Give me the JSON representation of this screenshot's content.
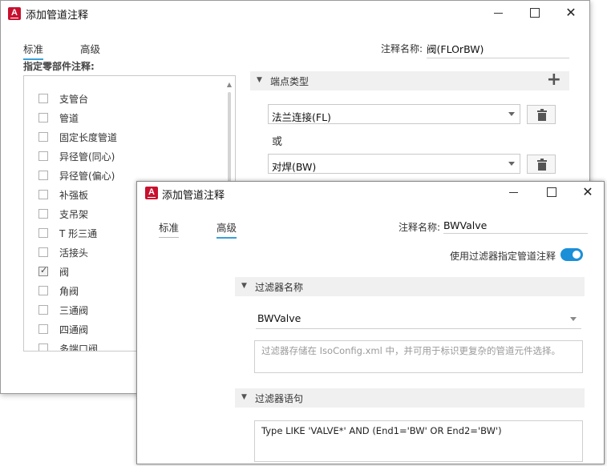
{
  "back_window": {
    "app_icon": "A",
    "title": "添加管道注释",
    "tabs": [
      {
        "label": "标准",
        "active": true
      },
      {
        "label": "高级",
        "active": false
      }
    ],
    "annotation_name_label": "注释名称:",
    "annotation_name_value": "阀(FLOrBW)",
    "parts_label": "指定零部件注释:",
    "parts": [
      {
        "label": "支管台",
        "checked": false
      },
      {
        "label": "管道",
        "checked": false
      },
      {
        "label": "固定长度管道",
        "checked": false
      },
      {
        "label": "异径管(同心)",
        "checked": false
      },
      {
        "label": "异径管(偏心)",
        "checked": false
      },
      {
        "label": "补强板",
        "checked": false
      },
      {
        "label": "支吊架",
        "checked": false
      },
      {
        "label": "T 形三通",
        "checked": false
      },
      {
        "label": "活接头",
        "checked": false
      },
      {
        "label": "阀",
        "checked": true
      },
      {
        "label": "角阀",
        "checked": false
      },
      {
        "label": "三通阀",
        "checked": false
      },
      {
        "label": "四通阀",
        "checked": false
      },
      {
        "label": "多端口阀",
        "checked": false
      }
    ],
    "endpoint_section": {
      "title": "端点类型",
      "option1": "法兰连接(FL)",
      "or_label": "或",
      "option2": "对焊(BW)"
    }
  },
  "front_window": {
    "app_icon": "A",
    "title": "添加管道注释",
    "tabs": [
      {
        "label": "标准",
        "active": false
      },
      {
        "label": "高级",
        "active": true
      }
    ],
    "annotation_name_label": "注释名称:",
    "annotation_name_value": "BWValve",
    "filter_toggle_label": "使用过滤器指定管道注释",
    "filter_toggle_on": true,
    "filter_name_section": {
      "title": "过滤器名称",
      "selected": "BWValve",
      "hint": "过滤器存储在 IsoConfig.xml 中，并可用于标识更复杂的管道元件选择。"
    },
    "filter_statement_section": {
      "title": "过滤器语句",
      "statement": "Type LIKE 'VALVE*' AND (End1='BW' OR End2='BW')"
    }
  },
  "colors": {
    "accent": "#1b8fd8",
    "tab_underline": "#3aa0d8",
    "app_icon_red": "#c8102e",
    "section_bg": "#f0f0f0"
  }
}
